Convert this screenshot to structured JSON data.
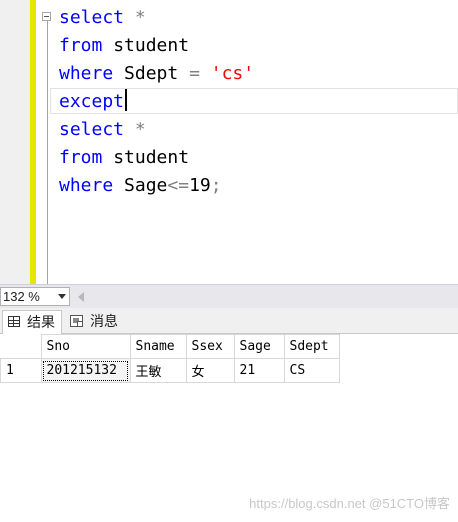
{
  "editor": {
    "lines": [
      {
        "keyword": "select",
        "rest_op": "*"
      },
      {
        "keyword": "from",
        "rest": "student"
      },
      {
        "keyword": "where",
        "field": "Sdept",
        "op": "=",
        "string": "'cs'"
      },
      {
        "keyword": "except"
      },
      {
        "keyword": "select",
        "rest_op": "*"
      },
      {
        "keyword": "from",
        "rest": "student"
      },
      {
        "keyword": "where",
        "field": "Sage",
        "op": "<=",
        "number": "19",
        "end": ";"
      }
    ]
  },
  "zoom": {
    "value": "132 %"
  },
  "tabs": {
    "results_label": "结果",
    "messages_label": "消息"
  },
  "results": {
    "columns": [
      "Sno",
      "Sname",
      "Ssex",
      "Sage",
      "Sdept"
    ],
    "rows": [
      {
        "num": "1",
        "cells": [
          "201215132",
          "王敏",
          "女",
          "21",
          "CS"
        ]
      }
    ]
  },
  "watermark": "https://blog.csdn.net @51CTO博客",
  "colors": {
    "keyword": "#0000ff",
    "string": "#ff0000",
    "operator": "#808080",
    "change_bar": "#e6e600"
  }
}
